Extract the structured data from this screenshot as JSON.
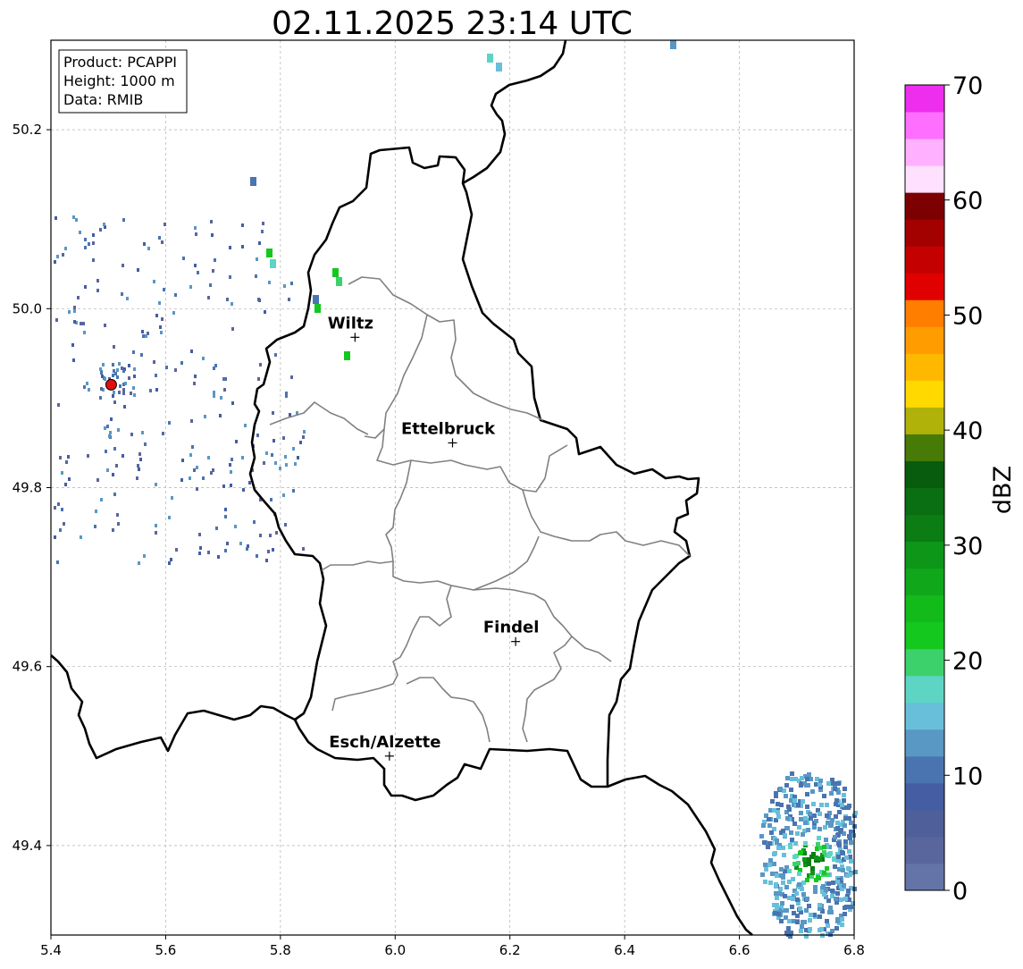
{
  "title": "02.11.2025 23:14 UTC",
  "info_box": {
    "product": "Product: PCAPPI",
    "height": "Height: 1000 m",
    "data": "Data: RMIB"
  },
  "axes": {
    "x_ticks": [
      "5.4",
      "5.6",
      "5.8",
      "6.0",
      "6.2",
      "6.4",
      "6.6",
      "6.8"
    ],
    "y_ticks": [
      "49.4",
      "49.6",
      "49.8",
      "50.0",
      "50.2"
    ],
    "x_range": [
      5.4,
      6.8
    ],
    "y_range": [
      49.3,
      50.3
    ]
  },
  "colorbar": {
    "label": "dBZ",
    "ticks": [
      "0",
      "10",
      "20",
      "30",
      "40",
      "50",
      "60",
      "70"
    ],
    "range": [
      0,
      70
    ],
    "colors": [
      "#6474a8",
      "#59669e",
      "#4f5f9a",
      "#445da3",
      "#4a74b0",
      "#5997c4",
      "#68bfd9",
      "#5ed4c4",
      "#3dd16b",
      "#14c81e",
      "#12bb1a",
      "#10a81a",
      "#0e9618",
      "#0b7d14",
      "#0a6e12",
      "#075c0d",
      "#487a08",
      "#b0b20a",
      "#ffd900",
      "#ffb800",
      "#ff9c00",
      "#ff7e00",
      "#e00000",
      "#c40000",
      "#a30000",
      "#7c0000",
      "#ffe0ff",
      "#ffb0ff",
      "#ff6fff",
      "#ee2eee"
    ]
  },
  "cities": [
    {
      "name": "Wiltz",
      "lon": 5.93,
      "lat": 49.968
    },
    {
      "name": "Ettelbruck",
      "lon": 6.1,
      "lat": 49.85
    },
    {
      "name": "Findel",
      "lon": 6.21,
      "lat": 49.628
    },
    {
      "name": "Esch/Alzette",
      "lon": 5.99,
      "lat": 49.5
    }
  ],
  "radar_site": {
    "lon": 5.505,
    "lat": 49.915,
    "color": "#e01010"
  }
}
